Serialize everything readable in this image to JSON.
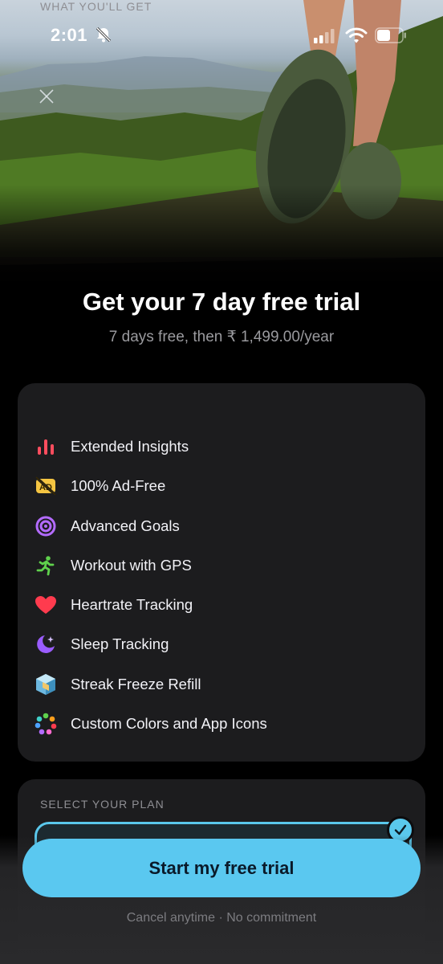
{
  "status_bar": {
    "time": "2:01",
    "icons": [
      "bell-slash-icon",
      "cellular-signal-icon",
      "wifi-icon",
      "battery-icon"
    ]
  },
  "hero": {
    "close_icon": "close-icon"
  },
  "header": {
    "title": "Get your 7 day free trial",
    "subtitle": "7 days free, then ₹ 1,499.00/year"
  },
  "features": {
    "heading": "WHAT YOU'LL GET",
    "items": [
      {
        "label": "Extended Insights",
        "icon": "bar-chart-icon",
        "color": "#ff4d5e"
      },
      {
        "label": "100% Ad-Free",
        "icon": "ad-free-icon",
        "color": "#f5c542"
      },
      {
        "label": "Advanced Goals",
        "icon": "target-icon",
        "color": "#b36bff"
      },
      {
        "label": "Workout with GPS",
        "icon": "running-figure-icon",
        "color": "#5fd14c"
      },
      {
        "label": "Heartrate Tracking",
        "icon": "heart-icon",
        "color": "#ff3b4e"
      },
      {
        "label": "Sleep Tracking",
        "icon": "moon-star-icon",
        "color": "#9a5cff"
      },
      {
        "label": "Streak Freeze Refill",
        "icon": "ice-cube-icon",
        "color": "#8fd0f0"
      },
      {
        "label": "Custom Colors and App Icons",
        "icon": "color-palette-icon",
        "color": "#ff6b9a"
      }
    ]
  },
  "plan": {
    "heading": "SELECT YOUR PLAN",
    "selected": true
  },
  "cta": {
    "label": "Start my free trial"
  },
  "footer": {
    "note": "Cancel anytime · No commitment"
  },
  "colors": {
    "accent": "#5ac8f0",
    "card": "#1c1c1e",
    "background": "#000000"
  }
}
